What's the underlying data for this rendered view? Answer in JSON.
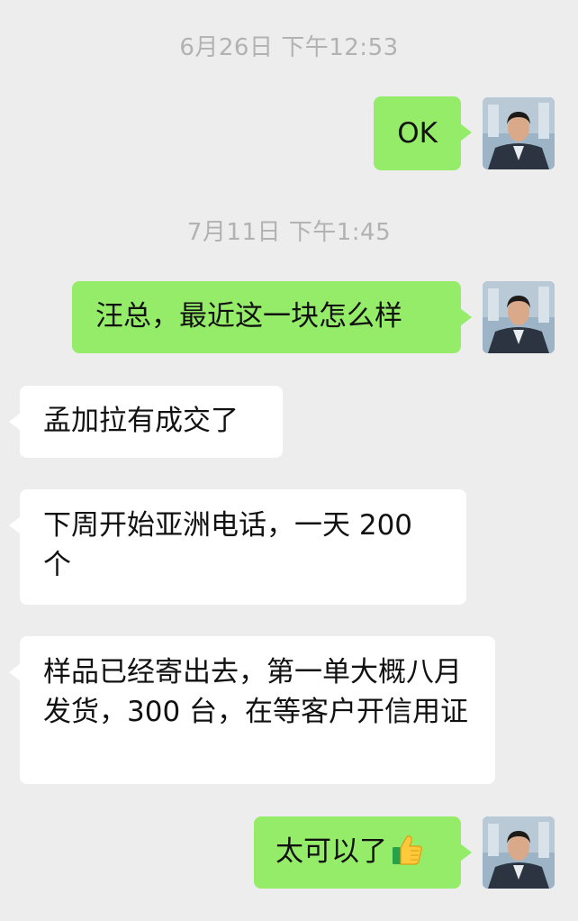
{
  "timestamps": [
    "6月26日 下午12:53",
    "7月11日 下午1:45"
  ],
  "messages": [
    {
      "direction": "outgoing",
      "text": "OK"
    },
    {
      "direction": "outgoing",
      "text": "汪总，最近这一块怎么样"
    },
    {
      "direction": "incoming",
      "text": "孟加拉有成交了"
    },
    {
      "direction": "incoming",
      "text": "下周开始亚洲电话，一天 200 个"
    },
    {
      "direction": "incoming",
      "text": "样品已经寄出去，第一单大概八月发货，300 台，在等客户开信用证"
    },
    {
      "direction": "outgoing",
      "text": "太可以了",
      "emoji": "thumbs-up-icon"
    }
  ],
  "colors": {
    "background": "#ededed",
    "outgoing_bubble": "#95ec69",
    "incoming_bubble": "#ffffff",
    "timestamp_text": "#b2b2b2"
  }
}
